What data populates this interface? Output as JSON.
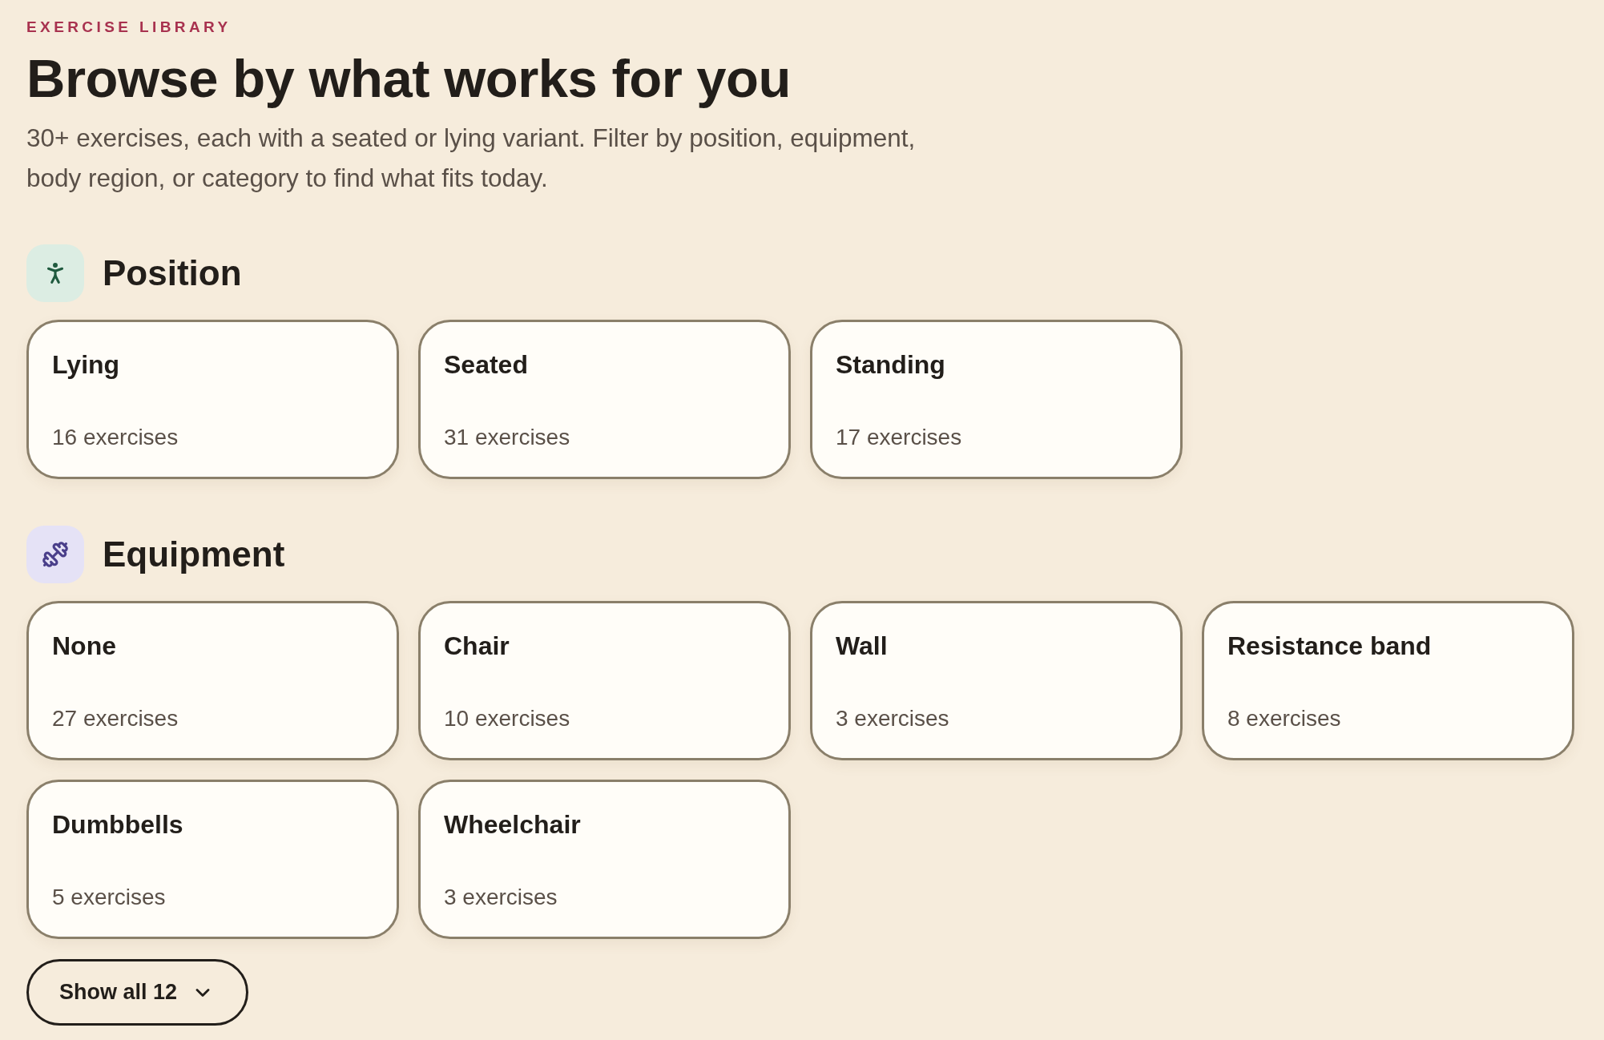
{
  "eyebrow": "EXERCISE LIBRARY",
  "title": "Browse by what works for you",
  "intro": "30+ exercises, each with a seated or lying variant. Filter by position, equipment, body region, or category to find what fits today.",
  "sections": [
    {
      "kind": "position",
      "title": "Position",
      "cards": [
        {
          "label": "Lying",
          "count": "16 exercises"
        },
        {
          "label": "Seated",
          "count": "31 exercises"
        },
        {
          "label": "Standing",
          "count": "17 exercises"
        }
      ]
    },
    {
      "kind": "equipment",
      "title": "Equipment",
      "cards": [
        {
          "label": "None",
          "count": "27 exercises"
        },
        {
          "label": "Chair",
          "count": "10 exercises"
        },
        {
          "label": "Wall",
          "count": "3 exercises"
        },
        {
          "label": "Resistance band",
          "count": "8 exercises"
        },
        {
          "label": "Dumbbells",
          "count": "5 exercises"
        },
        {
          "label": "Wheelchair",
          "count": "3 exercises"
        }
      ],
      "show_all": {
        "label": "Show all 12",
        "expanded": false
      }
    }
  ]
}
